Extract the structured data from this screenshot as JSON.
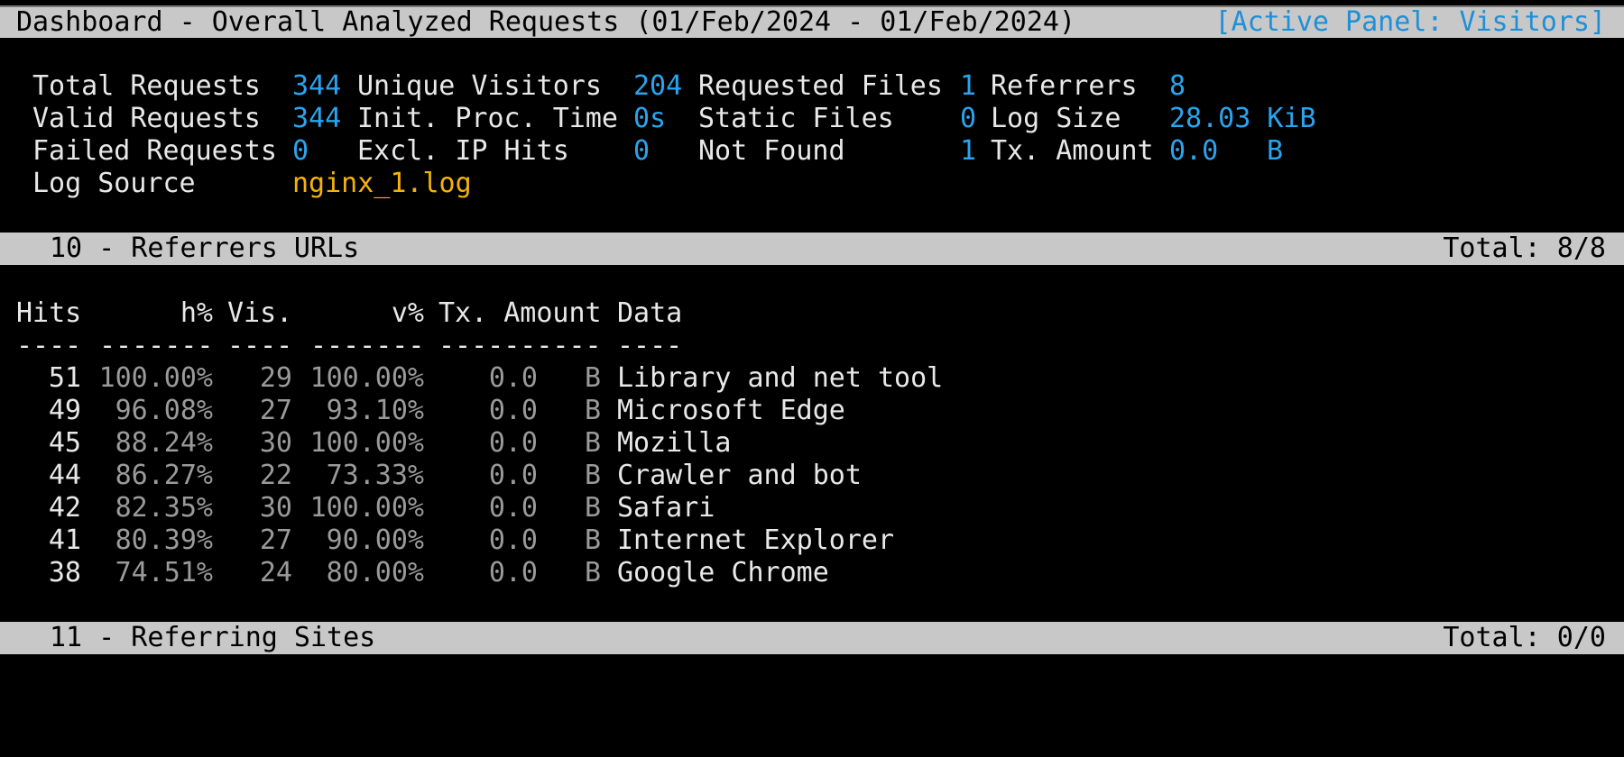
{
  "header": {
    "title": "Dashboard - Overall Analyzed Requests (01/Feb/2024 - 01/Feb/2024)",
    "active_panel": "[Active Panel: Visitors]"
  },
  "stats": {
    "total_requests_label": "Total Requests",
    "total_requests": "344",
    "unique_visitors_label": "Unique Visitors",
    "unique_visitors": "204",
    "requested_files_label": "Requested Files",
    "requested_files": "1",
    "referrers_label": "Referrers",
    "referrers": "8",
    "valid_requests_label": "Valid Requests",
    "valid_requests": "344",
    "init_proc_time_label": "Init. Proc. Time",
    "init_proc_time": "0s",
    "static_files_label": "Static Files",
    "static_files": "0",
    "log_size_label": "Log Size",
    "log_size": "28.03 KiB",
    "failed_requests_label": "Failed Requests",
    "failed_requests": "0",
    "excl_ip_hits_label": "Excl. IP Hits",
    "excl_ip_hits": "0",
    "not_found_label": "Not Found",
    "not_found": "1",
    "tx_amount_label": "Tx. Amount",
    "tx_amount": "0.0",
    "tx_amount_unit": "B",
    "log_source_label": "Log Source",
    "log_source": "nginx_1.log"
  },
  "panel_referrers": {
    "title": "10 - Referrers URLs",
    "total": "Total: 8/8",
    "columns": [
      "Hits",
      "h%",
      "Vis.",
      "v%",
      "Tx. Amount",
      "Data"
    ],
    "separators": [
      "----",
      "-------",
      "----",
      "-------",
      "----------",
      "----"
    ],
    "rows": [
      {
        "hits": "51",
        "hpct": "100.00%",
        "vis": "29",
        "vpct": "100.00%",
        "tx": "0.0",
        "unit": "B",
        "data": "Library and net tool"
      },
      {
        "hits": "49",
        "hpct": "96.08%",
        "vis": "27",
        "vpct": "93.10%",
        "tx": "0.0",
        "unit": "B",
        "data": "Microsoft Edge"
      },
      {
        "hits": "45",
        "hpct": "88.24%",
        "vis": "30",
        "vpct": "100.00%",
        "tx": "0.0",
        "unit": "B",
        "data": "Mozilla"
      },
      {
        "hits": "44",
        "hpct": "86.27%",
        "vis": "22",
        "vpct": "73.33%",
        "tx": "0.0",
        "unit": "B",
        "data": "Crawler and bot"
      },
      {
        "hits": "42",
        "hpct": "82.35%",
        "vis": "30",
        "vpct": "100.00%",
        "tx": "0.0",
        "unit": "B",
        "data": "Safari"
      },
      {
        "hits": "41",
        "hpct": "80.39%",
        "vis": "27",
        "vpct": "90.00%",
        "tx": "0.0",
        "unit": "B",
        "data": "Internet Explorer"
      },
      {
        "hits": "38",
        "hpct": "74.51%",
        "vis": "24",
        "vpct": "80.00%",
        "tx": "0.0",
        "unit": "B",
        "data": "Google Chrome"
      }
    ]
  },
  "panel_sites": {
    "title": "11 - Referring Sites",
    "total": "Total: 0/0"
  }
}
